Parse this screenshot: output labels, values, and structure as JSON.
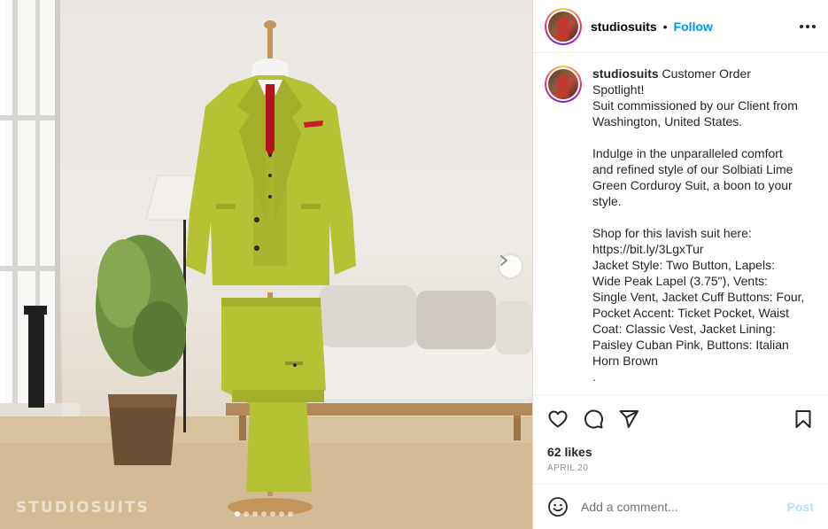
{
  "post": {
    "username": "studiosuits",
    "separator": "•",
    "follow_label": "Follow",
    "more_icon": "more-horizontal-icon"
  },
  "caption": {
    "username": "studiosuits",
    "text": " Customer Order Spotlight!\nSuit commissioned by our Client from Washington, United States.\n\nIndulge in the unparalleled comfort and refined style of our Solbiati Lime Green Corduroy Suit, a boon to your style.\n\nShop for this lavish suit here: https://bit.ly/3LgxTur\nJacket Style: Two Button, Lapels: Wide Peak Lapel (3.75\"), Vents: Single Vent, Jacket Cuff Buttons: Four, Pocket Accent: Ticket Pocket, Waist Coat: Classic Vest, Jacket Lining: Paisley Cuban Pink, Buttons: Italian Horn Brown\n."
  },
  "photo": {
    "watermark": "STUDIOSUITS",
    "carousel_total": 7,
    "carousel_current": 1
  },
  "actions": {
    "like_icon": "heart-icon",
    "comment_icon": "comment-icon",
    "share_icon": "send-icon",
    "save_icon": "bookmark-icon"
  },
  "likes": "62 likes",
  "date": "APRIL 20",
  "comment": {
    "placeholder": "Add a comment...",
    "post_label": "Post",
    "emoji_icon": "emoji-icon"
  },
  "colors": {
    "accent": "#0095f6",
    "post_disabled": "#b2dffc",
    "suit": "#b5c234"
  }
}
